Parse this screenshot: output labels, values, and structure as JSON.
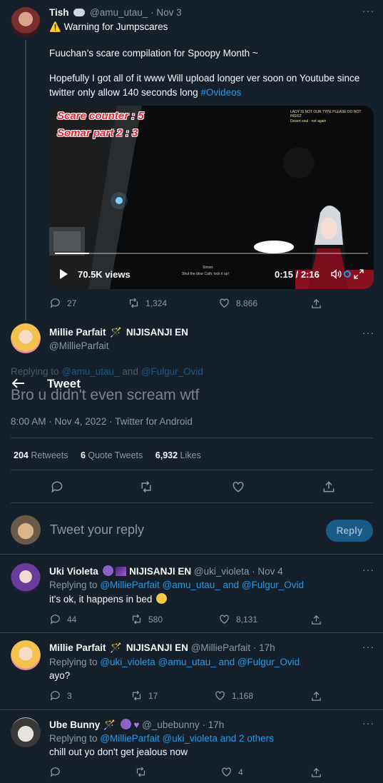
{
  "quoted_tweet": {
    "author_name": "Tish",
    "handle": "@amu_utau_",
    "date": "· Nov 3",
    "warning_icon": "⚠️",
    "warning_text": "Warning for Jumpscares",
    "line2": "Fuuchan’s scare compilation for Spoopy Month ~",
    "line3": "Hopefully I got all of it www Will upload longer ver soon on Youtube since twitter only allow 140 seconds long",
    "hashtag": "#Ovideos",
    "video": {
      "overlay_line1": "Scare counter : 5",
      "overlay_line2": "Somar part 2 : 3",
      "chat_line1": "LADY IS NOT OUR TYPE PLEASE DO NOT INSIST",
      "chat_line2": "Desert soul · not again",
      "subtitle_name": "Simon:",
      "subtitle_text": "Shut the door Cath, lock it up!",
      "views": "70.5K views",
      "time": "0:15 / 2:16",
      "progress": 0.11
    },
    "replies": "27",
    "retweets": "1,324",
    "likes": "8,866"
  },
  "main_tweet": {
    "author_name": "Millie Parfait",
    "org": "NIJISANJI EN",
    "handle": "@MillieParfait",
    "replying_to_label": "Replying to",
    "replying_to_1": "@amu_utau_",
    "replying_to_and": "and",
    "replying_to_2": "@Fulgur_Ovid",
    "header_title": "Tweet",
    "text": "Bro u didn't even scream wtf",
    "meta": "8:00 AM · Nov 4, 2022 · Twitter for Android",
    "retweets_count": "204",
    "retweets_label": "Retweets",
    "quotes_count": "6",
    "quotes_label": "Quote Tweets",
    "likes_count": "6,932",
    "likes_label": "Likes"
  },
  "compose": {
    "placeholder": "Tweet your reply",
    "reply_button": "Reply"
  },
  "replies": [
    {
      "author_name": "Uki Violeta",
      "org": "NIJISANJI EN",
      "handle": "@uki_violeta",
      "date": "· Nov 4",
      "replying_to_label": "Replying to",
      "replying_to": "@MillieParfait @amu_utau_ and @Fulgur_Ovid",
      "text": "it's ok, it happens in bed",
      "replies": "44",
      "retweets": "580",
      "likes": "8,131"
    },
    {
      "author_name": "Millie Parfait",
      "org": "NIJISANJI EN",
      "handle": "@MillieParfait",
      "date": "· 17h",
      "replying_to_label": "Replying to",
      "replying_to": "@uki_violeta @amu_utau_ and @Fulgur_Ovid",
      "text": "ayo?",
      "replies": "3",
      "retweets": "17",
      "likes": "1,168"
    },
    {
      "author_name": "Ube Bunny",
      "handle": "@_ubebunny",
      "date": "· 17h",
      "replying_to_label": "Replying to",
      "replying_to": "@MillieParfait @uki_violeta and 2 others",
      "text": "chill out yo don't get jealous now",
      "replies": "",
      "retweets": "",
      "likes": "4"
    }
  ],
  "colors": {
    "background": "#15202b",
    "accent": "#1d9bf0",
    "muted": "#8b98a5",
    "divider": "#38444d"
  }
}
